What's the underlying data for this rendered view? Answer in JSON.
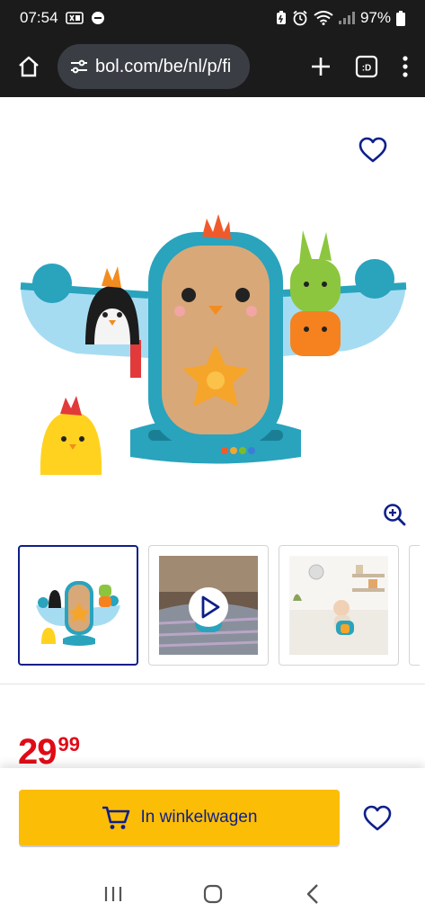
{
  "status_bar": {
    "time": "07:54",
    "battery": "97%"
  },
  "browser": {
    "url": "bol.com/be/nl/p/fi"
  },
  "product": {
    "price_main": "29",
    "price_cents": "99",
    "thumbnails": [
      {
        "label": "product-photo"
      },
      {
        "label": "product-video"
      },
      {
        "label": "lifestyle-photo"
      }
    ]
  },
  "cart": {
    "button_label": "In winkelwagen"
  },
  "colors": {
    "brand_blue": "#0e1f8a",
    "cart_yellow": "#fcbd07",
    "price_red": "#e00b17"
  }
}
